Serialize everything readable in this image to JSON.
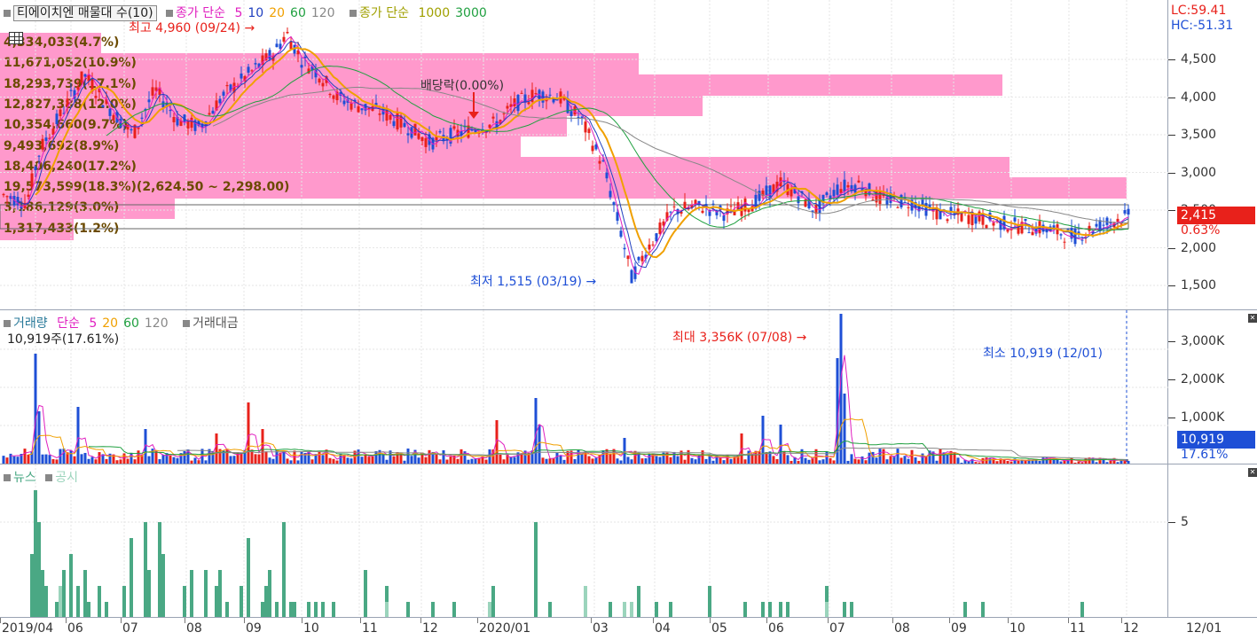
{
  "price_pane": {
    "legend": {
      "title": "티에이치엔 매물대 수(10)",
      "ma_label": "종가 단순",
      "ma_periods": [
        {
          "label": "5",
          "color": "#e020c0"
        },
        {
          "label": "10",
          "color": "#2040c0"
        },
        {
          "label": "20",
          "color": "#f0a000"
        },
        {
          "label": "60",
          "color": "#20a040"
        },
        {
          "label": "120",
          "color": "#888888"
        }
      ],
      "ma2_label": "종가 단순",
      "ma2_periods": [
        {
          "label": "1000",
          "color": "#a0a000"
        },
        {
          "label": "3000",
          "color": "#20a040"
        }
      ]
    },
    "lc": "LC:59.41",
    "hc": "HC:-51.31",
    "y_ticks": [
      "4,500",
      "4,000",
      "3,500",
      "3,000",
      "2,500",
      "2,000",
      "1,500"
    ],
    "current_price": "2,415",
    "current_change": "0.63%",
    "high_annotation": "최고 4,960 (09/24)",
    "low_annotation": "최저 1,515 (03/19)",
    "dividend_annotation": "배당락(0.00%)",
    "volume_profile": [
      {
        "label": "4,334,033(4.7%)",
        "fraction": 0.09
      },
      {
        "label": "11,671,052(10.9%)",
        "fraction": 0.567
      },
      {
        "label": "18,293,739(17.1%)",
        "fraction": 0.89
      },
      {
        "label": "12,827,388(12.0%)",
        "fraction": 0.624
      },
      {
        "label": "10,354,660(9.7%)",
        "fraction": 0.503
      },
      {
        "label": "9,493,692(8.9%)",
        "fraction": 0.462
      },
      {
        "label": "18,406,240(17.2%)",
        "fraction": 0.896
      },
      {
        "label": "19,573,599(18.3%)(2,624.50 ~ 2,298.00)",
        "fraction": 1.0
      },
      {
        "label": "3,186,129(3.0%)",
        "fraction": 0.155
      },
      {
        "label": "1,317,433(1.2%)",
        "fraction": 0.065
      }
    ]
  },
  "volume_pane": {
    "legend": {
      "title": "거래량",
      "ma_label": "단순",
      "ma_periods": [
        {
          "label": "5",
          "color": "#e020c0"
        },
        {
          "label": "20",
          "color": "#f0a000"
        },
        {
          "label": "60",
          "color": "#20a040"
        },
        {
          "label": "120",
          "color": "#888888"
        }
      ],
      "extra": "거래대금"
    },
    "info": "10,919주(17.61%)",
    "y_ticks": [
      "3,000K",
      "2,000K",
      "1,000K"
    ],
    "current_value": "10,919",
    "current_pct": "17.61%",
    "max_annotation": "최대 3,356K (07/08)",
    "min_annotation": "최소 10,919 (12/01)"
  },
  "news_pane": {
    "legend": {
      "news": "뉴스",
      "disclosure": "공시"
    },
    "y_ticks": [
      "5"
    ]
  },
  "x_axis": {
    "labels": [
      "2019/04",
      "06",
      "07",
      "08",
      "09",
      "10",
      "11",
      "12",
      "2020/01",
      "03",
      "04",
      "05",
      "06",
      "07",
      "08",
      "09",
      "10",
      "11",
      "12"
    ],
    "current_date": "12/01"
  },
  "colors": {
    "up": "#e8211b",
    "down": "#1e4fd6",
    "profile": "#ff99cc",
    "news": "#4aa884",
    "disclosure": "#9bd4bc",
    "ma5": "#e020c0",
    "ma10": "#2040c0",
    "ma20": "#f0a000",
    "ma60": "#20a040",
    "ma120": "#888888"
  }
}
